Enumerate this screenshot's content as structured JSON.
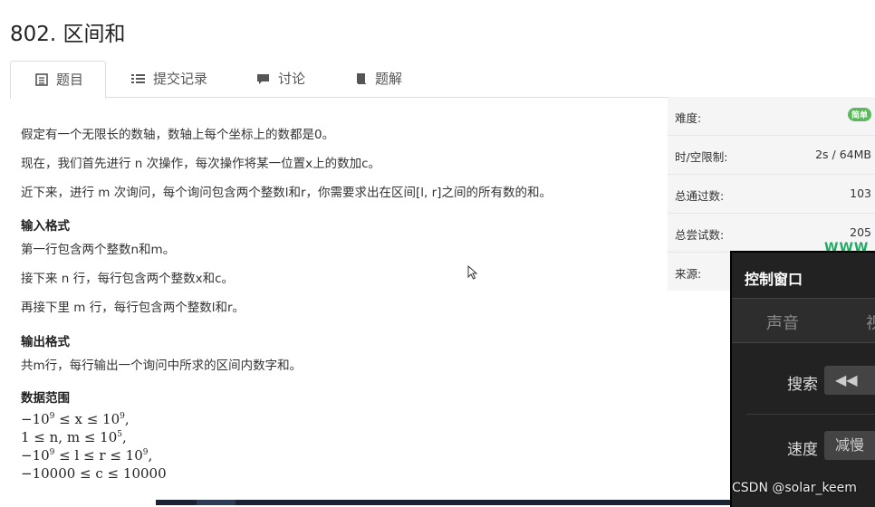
{
  "problem": {
    "title": "802. 区间和"
  },
  "tabs": [
    {
      "label": "题目",
      "icon": "list-alt-icon"
    },
    {
      "label": "提交记录",
      "icon": "list-icon"
    },
    {
      "label": "讨论",
      "icon": "comment-icon"
    },
    {
      "label": "题解",
      "icon": "book-icon"
    }
  ],
  "statement": {
    "p1": "假定有一个无限长的数轴，数轴上每个坐标上的数都是0。",
    "p2": "现在，我们首先进行 n 次操作，每次操作将某一位置x上的数加c。",
    "p3": "近下来，进行 m 次询问，每个询问包含两个整数l和r，你需要求出在区间[l, r]之间的所有数的和。",
    "input_heading": "输入格式",
    "input_1": "第一行包含两个整数n和m。",
    "input_2": "接下来 n 行，每行包含两个整数x和c。",
    "input_3": "再接下里 m 行，每行包含两个整数l和r。",
    "output_heading": "输出格式",
    "output_1": "共m行，每行输出一个询问中所求的区间内数字和。",
    "range_heading": "数据范围",
    "range": [
      {
        "pre": "−10",
        "sup1": "9",
        "mid": " ≤ x ≤ 10",
        "sup2": "9",
        "post": ","
      },
      {
        "pre": "1 ≤ n, m ≤ 10",
        "sup1": "5",
        "mid": "",
        "sup2": "",
        "post": ","
      },
      {
        "pre": "−10",
        "sup1": "9",
        "mid": " ≤ l ≤ r ≤ 10",
        "sup2": "9",
        "post": ","
      },
      {
        "pre": "−10000 ≤ c ≤ 10000",
        "sup1": "",
        "mid": "",
        "sup2": "",
        "post": ""
      }
    ]
  },
  "sidebar": {
    "difficulty_label": "难度:",
    "difficulty_value": "简单",
    "limit_label": "时/空限制:",
    "limit_value": "2s / 64MB",
    "passed_label": "总通过数:",
    "passed_value": "103",
    "tried_label": "总尝试数:",
    "tried_value": "205",
    "source_label": "来源:",
    "source_value": ""
  },
  "overlay_text": "WWW",
  "control_window": {
    "title": "控制窗口",
    "tab_sound": "声音",
    "tab_video": "视",
    "search_label": "搜索",
    "search_button": "◀◀",
    "speed_label": "速度",
    "speed_button": "减慢"
  },
  "watermark": "CSDN @solar_keem",
  "colors": {
    "badge": "#5cb85c",
    "sidebar_bg": "#f5f5f5",
    "control_bg": "#222222"
  }
}
